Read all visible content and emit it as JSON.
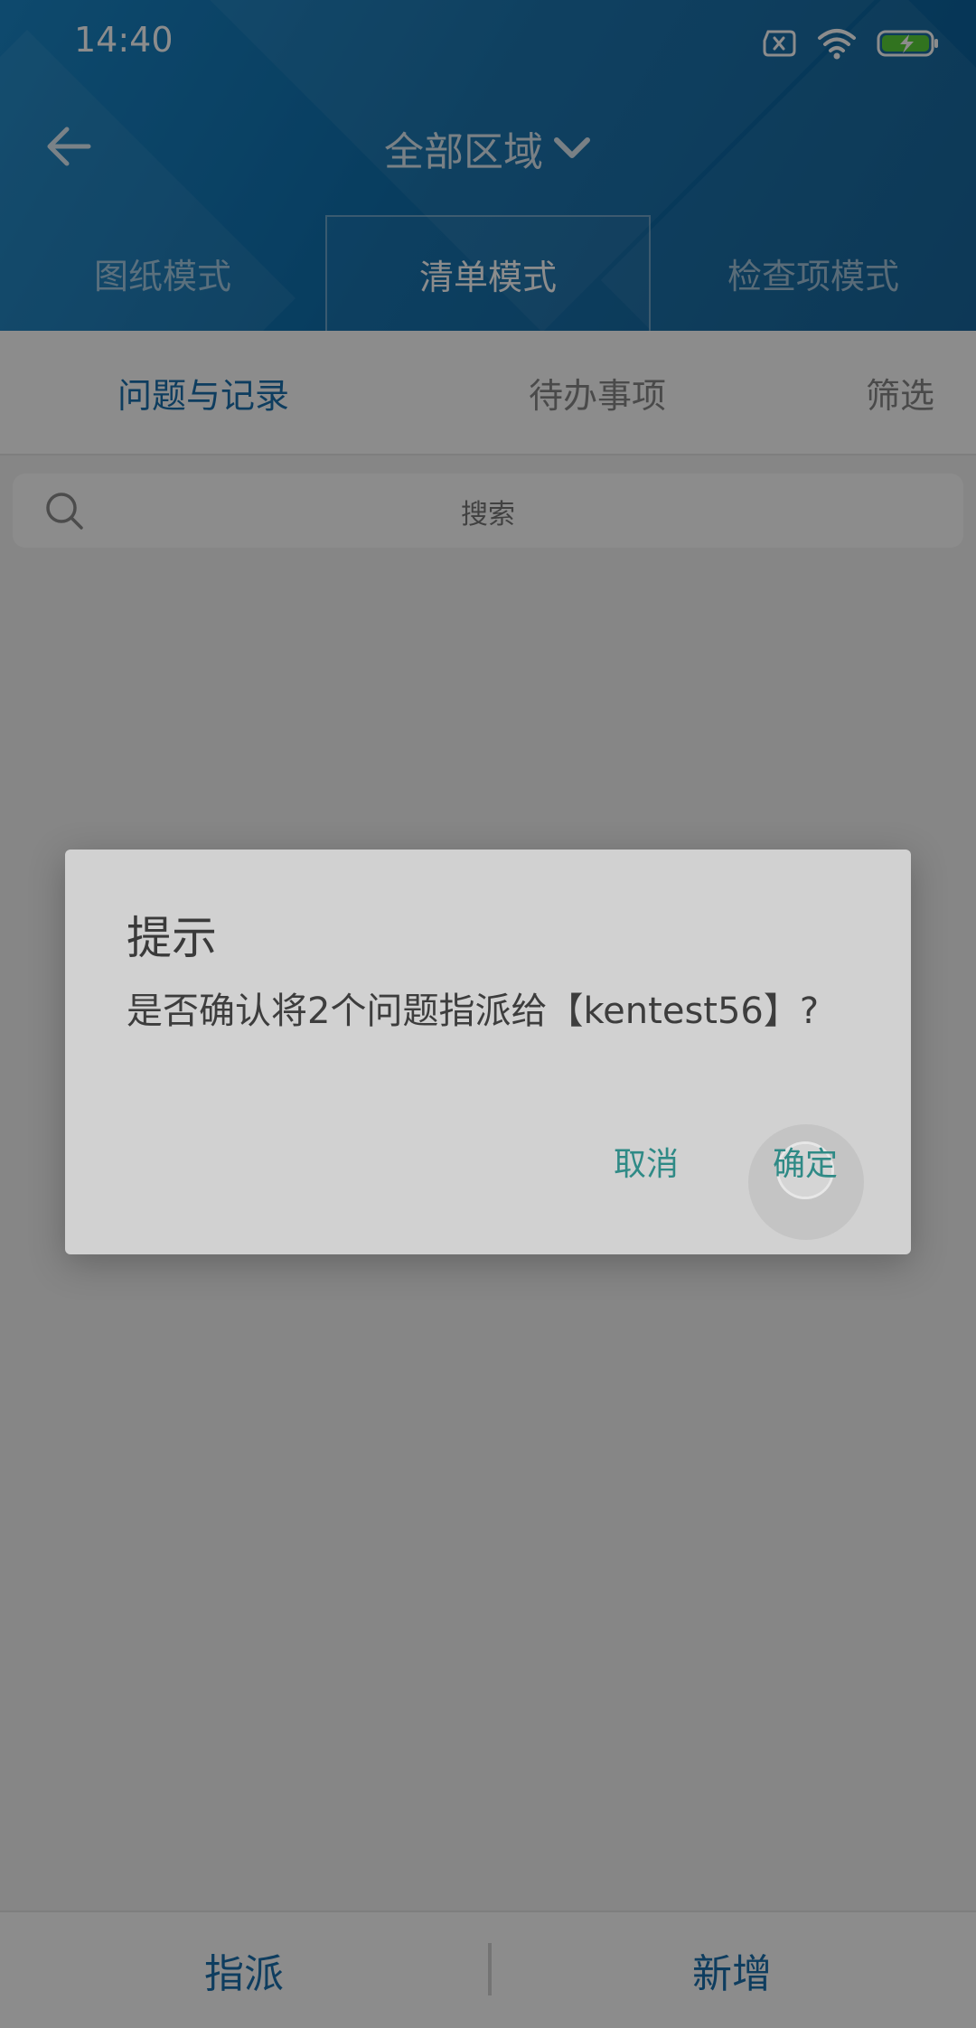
{
  "status_bar": {
    "time": "14:40"
  },
  "nav": {
    "area_title": "全部区域"
  },
  "mode_tabs": [
    {
      "label": "图纸模式"
    },
    {
      "label": "清单模式"
    },
    {
      "label": "检查项模式"
    }
  ],
  "active_mode_tab": 1,
  "sub_tabs": [
    {
      "label": "问题与记录"
    },
    {
      "label": "待办事项"
    },
    {
      "label": "筛选"
    }
  ],
  "active_sub_tab": 0,
  "search": {
    "placeholder": "搜索"
  },
  "bottom_bar": {
    "assign_label": "指派",
    "add_label": "新增"
  },
  "dialog": {
    "title": "提示",
    "message": "是否确认将2个问题指派给【kentest56】?",
    "cancel_label": "取消",
    "confirm_label": "确定"
  },
  "colors": {
    "header_blue": "#0f6fad",
    "accent_blue": "#1a6fae",
    "dialog_button_teal": "#2f8a86"
  },
  "icons": {
    "back": "arrow-left-icon",
    "dropdown": "chevron-down-icon",
    "search": "search-icon",
    "sim": "no-sim-icon",
    "wifi": "wifi-icon",
    "battery": "battery-charging-icon"
  }
}
